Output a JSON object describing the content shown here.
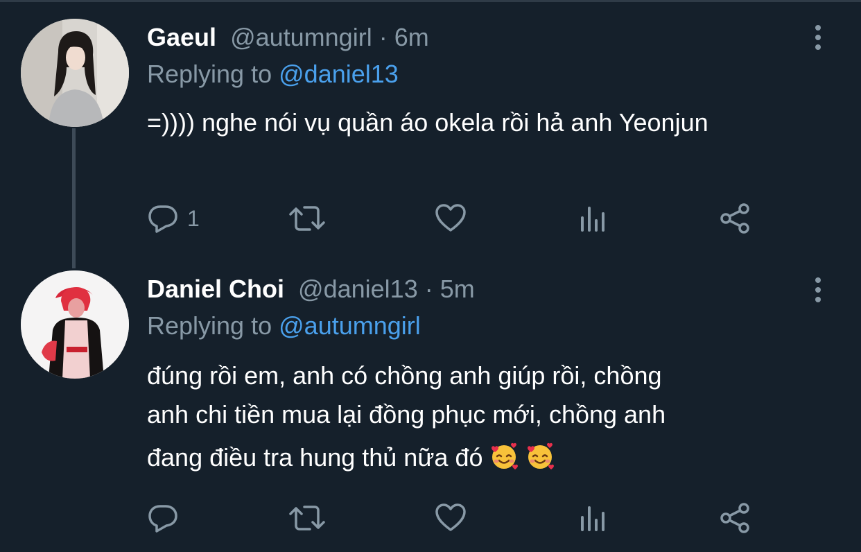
{
  "tweets": [
    {
      "name": "Gaeul",
      "handle": "@autumngirl",
      "separator": "·",
      "time": "6m",
      "replying_prefix": "Replying to",
      "replying_to": "@daniel13",
      "text": "=)))) nghe nói vụ quần áo okela rồi hả anh Yeonjun",
      "reply_count": "1",
      "icons": [
        "reply-icon",
        "retweet-icon",
        "like-icon",
        "analytics-icon",
        "share-icon",
        "more-icon"
      ]
    },
    {
      "name": "Daniel Choi",
      "handle": "@daniel13",
      "separator": "·",
      "time": "5m",
      "replying_prefix": "Replying to",
      "replying_to": "@autumngirl",
      "text_line1": "đúng rồi em, anh có chồng anh giúp rồi, chồng",
      "text_line2": "anh chi tiền mua lại đồng phục mới, chồng anh",
      "text_line3": "đang điều tra hung thủ nữa đó",
      "emoji": "smiling-face-with-hearts",
      "reply_count": "",
      "icons": [
        "reply-icon",
        "retweet-icon",
        "like-icon",
        "analytics-icon",
        "share-icon",
        "more-icon"
      ]
    }
  ],
  "colors": {
    "background": "#15202b",
    "secondary_text": "#8899a6",
    "mention": "#4aa0ec",
    "thread_line": "#3d4a57"
  }
}
